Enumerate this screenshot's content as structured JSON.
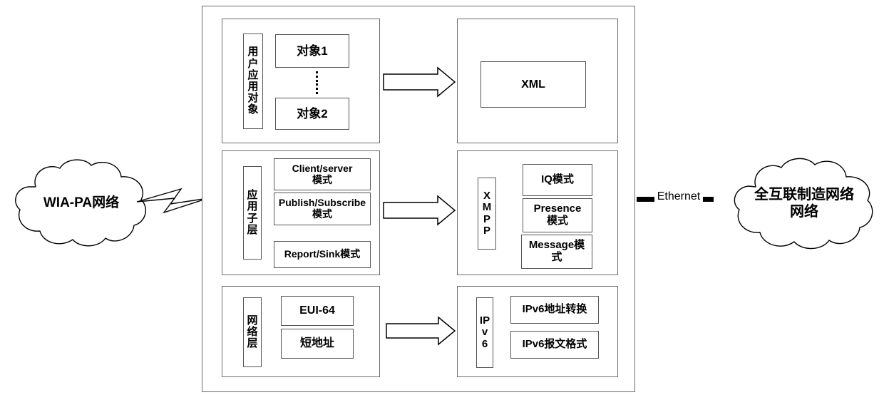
{
  "diagram": {
    "title": "WIA-PA to Fully-Connected Manufacturing Network protocol mapping",
    "left_cloud": {
      "name": "left-network-cloud",
      "lines": [
        "WIA-PA网络"
      ]
    },
    "right_cloud": {
      "name": "right-network-cloud",
      "lines": [
        "全互联制造网络",
        "网络"
      ]
    },
    "link": {
      "label": "Ethernet"
    },
    "wireless_link": {
      "icon": "lightning-bolt-icon"
    },
    "arrows": {
      "icon": "block-arrow-right-icon",
      "count": 3
    },
    "left_stack": [
      {
        "id": "user-application-object",
        "layer_label": "用户应用对象",
        "items": [
          "对象1",
          "对象2"
        ],
        "separator": "vertical-dots"
      },
      {
        "id": "application-sublayer",
        "layer_label": "应用子层",
        "items": [
          "Client/server\n模式",
          "Publish/Subscribe\n模式",
          "Report/Sink模式"
        ]
      },
      {
        "id": "network-layer",
        "layer_label": "网络层",
        "items": [
          "EUI-64",
          "短地址"
        ]
      }
    ],
    "right_stack": [
      {
        "id": "xml",
        "layer_label": "",
        "items": [
          "XML"
        ]
      },
      {
        "id": "xmpp",
        "layer_label": "XMPP",
        "items": [
          "IQ模式",
          "Presence\n模式",
          "Message模\n式"
        ]
      },
      {
        "id": "ipv6",
        "layer_label": "IPv6",
        "items": [
          "IPv6地址转换",
          "IPv6报文格式"
        ]
      }
    ],
    "colors": {
      "stroke": "#6b6b6b",
      "leaf_stroke": "#555555",
      "text": "#000000",
      "background": "#ffffff"
    }
  }
}
